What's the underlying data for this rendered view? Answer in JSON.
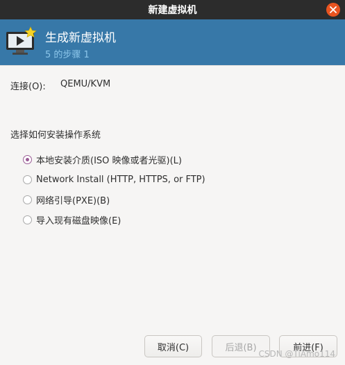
{
  "window": {
    "title": "新建虚拟机"
  },
  "header": {
    "title": "生成新虚拟机",
    "step": "5 的步骤 1"
  },
  "connection": {
    "label": "连接(O):",
    "value": "QEMU/KVM"
  },
  "install": {
    "section_title": "选择如何安装操作系统",
    "selected_index": 0,
    "options": [
      "本地安装介质(ISO 映像或者光驱)(L)",
      "Network Install (HTTP, HTTPS, or FTP)",
      "网络引导(PXE)(B)",
      "导入现有磁盘映像(E)"
    ]
  },
  "buttons": {
    "cancel": "取消(C)",
    "back": "后退(B)",
    "forward": "前进(F)"
  },
  "watermark": "CSDN @TiAmo114",
  "colors": {
    "titlebar": "#2c2c2c",
    "banner": "#3778a8",
    "close": "#e95420",
    "radio_accent": "#9a5b95"
  }
}
